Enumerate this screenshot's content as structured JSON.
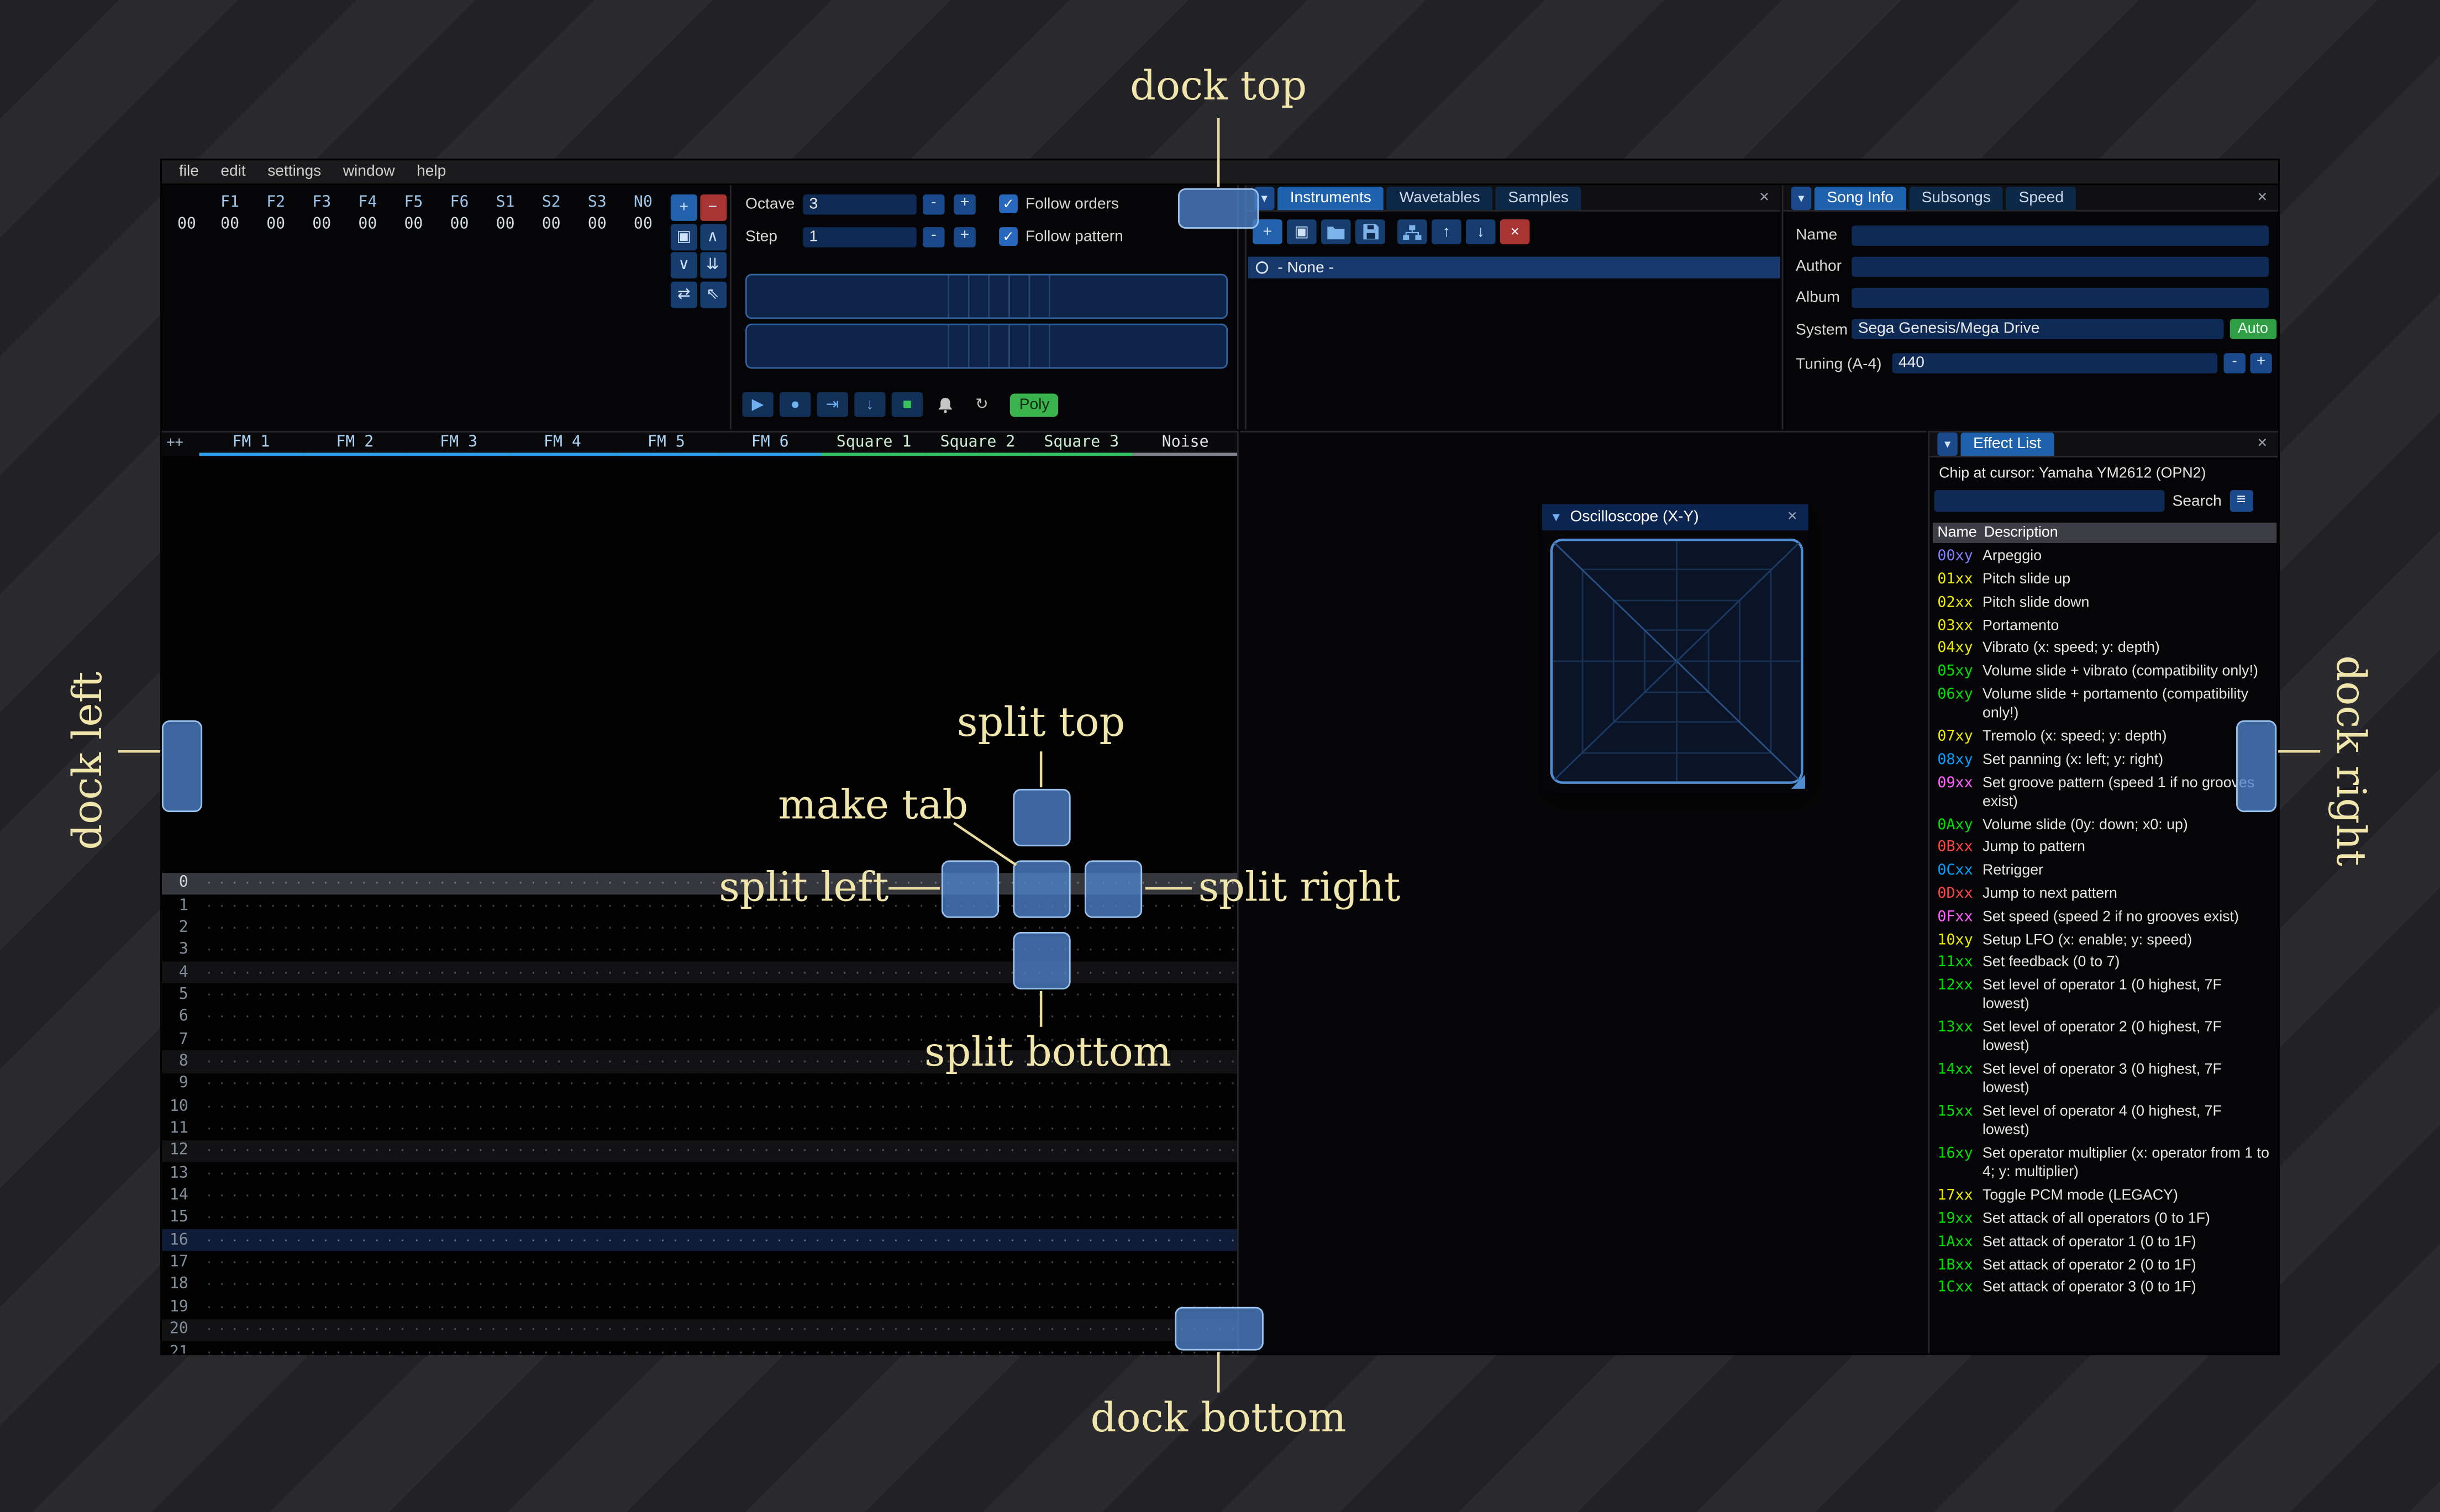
{
  "annotations": {
    "dock_top": "dock top",
    "dock_bottom": "dock bottom",
    "dock_left": "dock left",
    "dock_right": "dock right",
    "split_top": "split top",
    "split_bottom": "split bottom",
    "split_left": "split left",
    "split_right": "split right",
    "make_tab": "make tab"
  },
  "icons": {
    "plus": "+",
    "minus": "-",
    "check": "✓",
    "close": "×",
    "tab_arrow": "▾",
    "collapse": "▼",
    "hamburger": "≡",
    "repeat": "↻",
    "duplicate": "▣",
    "up": "↑",
    "down": "↓"
  },
  "menu": {
    "items": [
      "file",
      "edit",
      "settings",
      "window",
      "help"
    ]
  },
  "orders": {
    "channel_headers": [
      "F1",
      "F2",
      "F3",
      "F4",
      "F5",
      "F6",
      "S1",
      "S2",
      "S3",
      "N0"
    ],
    "order_index": "00",
    "pattern_values": [
      "00",
      "00",
      "00",
      "00",
      "00",
      "00",
      "00",
      "00",
      "00",
      "00"
    ],
    "buttons": [
      {
        "name": "add-order-button",
        "glyph": "+",
        "style": "add"
      },
      {
        "name": "remove-order-button",
        "glyph": "−",
        "style": "remove"
      },
      {
        "name": "duplicate-order-button",
        "glyph": "▣",
        "style": ""
      },
      {
        "name": "move-order-up-button",
        "glyph": "∧",
        "style": ""
      },
      {
        "name": "move-order-down-button",
        "glyph": "∨",
        "style": ""
      },
      {
        "name": "deep-clone-order-button",
        "glyph": "⇊",
        "style": ""
      },
      {
        "name": "change-all-orders-button",
        "glyph": "⇄",
        "style": ""
      },
      {
        "name": "order-edit-mode-button",
        "glyph": "⇖",
        "style": ""
      }
    ]
  },
  "play_controls": {
    "octave_label": "Octave",
    "octave_value": "3",
    "step_label": "Step",
    "step_value": "1",
    "follow_orders_label": "Follow orders",
    "follow_orders_checked": true,
    "follow_pattern_label": "Follow pattern",
    "follow_pattern_checked": true,
    "transport": [
      {
        "name": "play-button",
        "glyph": "▶",
        "style": ""
      },
      {
        "name": "stop-button",
        "glyph": "●",
        "style": ""
      },
      {
        "name": "play-from-cursor-button",
        "glyph": "⇥",
        "style": ""
      },
      {
        "name": "step-one-row-button",
        "glyph": "↓",
        "style": ""
      },
      {
        "name": "edit-toggle-button",
        "glyph": "■",
        "style": "green"
      }
    ],
    "poly_label": "Poly"
  },
  "instruments": {
    "tabs": [
      "Instruments",
      "Wavetables",
      "Samples"
    ],
    "selected": "Instruments",
    "list_items": [
      "- None -"
    ]
  },
  "song_info": {
    "tabs": [
      "Song Info",
      "Subsongs",
      "Speed"
    ],
    "selected": "Song Info",
    "name_label": "Name",
    "name_value": "",
    "author_label": "Author",
    "author_value": "",
    "album_label": "Album",
    "album_value": "",
    "system_label": "System",
    "system_value": "Sega Genesis/Mega Drive",
    "auto_label": "Auto",
    "tuning_label": "Tuning (A-4)",
    "tuning_value": "440"
  },
  "pattern": {
    "expand_label": "++",
    "channels": [
      {
        "label": "FM 1",
        "type": "fm"
      },
      {
        "label": "FM 2",
        "type": "fm"
      },
      {
        "label": "FM 3",
        "type": "fm"
      },
      {
        "label": "FM 4",
        "type": "fm"
      },
      {
        "label": "FM 5",
        "type": "fm"
      },
      {
        "label": "FM 6",
        "type": "fm"
      },
      {
        "label": "Square 1",
        "type": "square"
      },
      {
        "label": "Square 2",
        "type": "square"
      },
      {
        "label": "Square 3",
        "type": "square"
      },
      {
        "label": "Noise",
        "type": "noise"
      }
    ],
    "row_count": 22,
    "cursor_row": 0,
    "major_rows": [
      16
    ],
    "minor_rows": [
      4,
      8,
      12,
      20
    ],
    "empty_cell_dots": "················"
  },
  "oscilloscope": {
    "title": "Oscilloscope (X-Y)"
  },
  "effect_list": {
    "tab_label": "Effect List",
    "chip_line": "Chip at cursor: Yamaha YM2612 (OPN2)",
    "search_value": "",
    "search_label": "Search",
    "columns": {
      "name": "Name",
      "description": "Description"
    },
    "effects": [
      {
        "name": "00xy",
        "color": "#7f7fff",
        "desc": "Arpeggio"
      },
      {
        "name": "01xx",
        "color": "#eded00",
        "desc": "Pitch slide up"
      },
      {
        "name": "02xx",
        "color": "#eded00",
        "desc": "Pitch slide down"
      },
      {
        "name": "03xx",
        "color": "#eded00",
        "desc": "Portamento"
      },
      {
        "name": "04xy",
        "color": "#eded00",
        "desc": "Vibrato (x: speed; y: depth)"
      },
      {
        "name": "05xy",
        "color": "#00e000",
        "desc": "Volume slide + vibrato (compatibility only!)"
      },
      {
        "name": "06xy",
        "color": "#00e000",
        "desc": "Volume slide + portamento (compatibility only!)"
      },
      {
        "name": "07xy",
        "color": "#eded00",
        "desc": "Tremolo (x: speed; y: depth)"
      },
      {
        "name": "08xy",
        "color": "#00a0ff",
        "desc": "Set panning (x: left; y: right)"
      },
      {
        "name": "09xx",
        "color": "#ff60ff",
        "desc": "Set groove pattern (speed 1 if no grooves exist)"
      },
      {
        "name": "0Axy",
        "color": "#00e000",
        "desc": "Volume slide (0y: down; x0: up)"
      },
      {
        "name": "0Bxx",
        "color": "#ff4545",
        "desc": "Jump to pattern"
      },
      {
        "name": "0Cxx",
        "color": "#00a0ff",
        "desc": "Retrigger"
      },
      {
        "name": "0Dxx",
        "color": "#ff4545",
        "desc": "Jump to next pattern"
      },
      {
        "name": "0Fxx",
        "color": "#ff60ff",
        "desc": "Set speed (speed 2 if no grooves exist)"
      },
      {
        "name": "10xy",
        "color": "#eded00",
        "desc": "Setup LFO (x: enable; y: speed)"
      },
      {
        "name": "11xx",
        "color": "#00e000",
        "desc": "Set feedback (0 to 7)"
      },
      {
        "name": "12xx",
        "color": "#00e000",
        "desc": "Set level of operator 1 (0 highest, 7F lowest)"
      },
      {
        "name": "13xx",
        "color": "#00e000",
        "desc": "Set level of operator 2 (0 highest, 7F lowest)"
      },
      {
        "name": "14xx",
        "color": "#00e000",
        "desc": "Set level of operator 3 (0 highest, 7F lowest)"
      },
      {
        "name": "15xx",
        "color": "#00e000",
        "desc": "Set level of operator 4 (0 highest, 7F lowest)"
      },
      {
        "name": "16xy",
        "color": "#00e000",
        "desc": "Set operator multiplier (x: operator from 1 to 4; y: multiplier)"
      },
      {
        "name": "17xx",
        "color": "#eded00",
        "desc": "Toggle PCM mode (LEGACY)"
      },
      {
        "name": "19xx",
        "color": "#00e000",
        "desc": "Set attack of all operators (0 to 1F)"
      },
      {
        "name": "1Axx",
        "color": "#00e000",
        "desc": "Set attack of operator 1 (0 to 1F)"
      },
      {
        "name": "1Bxx",
        "color": "#00e000",
        "desc": "Set attack of operator 2 (0 to 1F)"
      },
      {
        "name": "1Cxx",
        "color": "#00e000",
        "desc": "Set attack of operator 3 (0 to 1F)"
      }
    ]
  },
  "colors": {
    "fm_channel": "#2e9fe6",
    "square_channel": "#34c065",
    "noise_channel": "#7d838c",
    "dock_overlay": "#4d83c9",
    "annotation": "#f0e5ab",
    "accent_blue": "#1e62ae",
    "auto_green": "#2f9e44"
  }
}
